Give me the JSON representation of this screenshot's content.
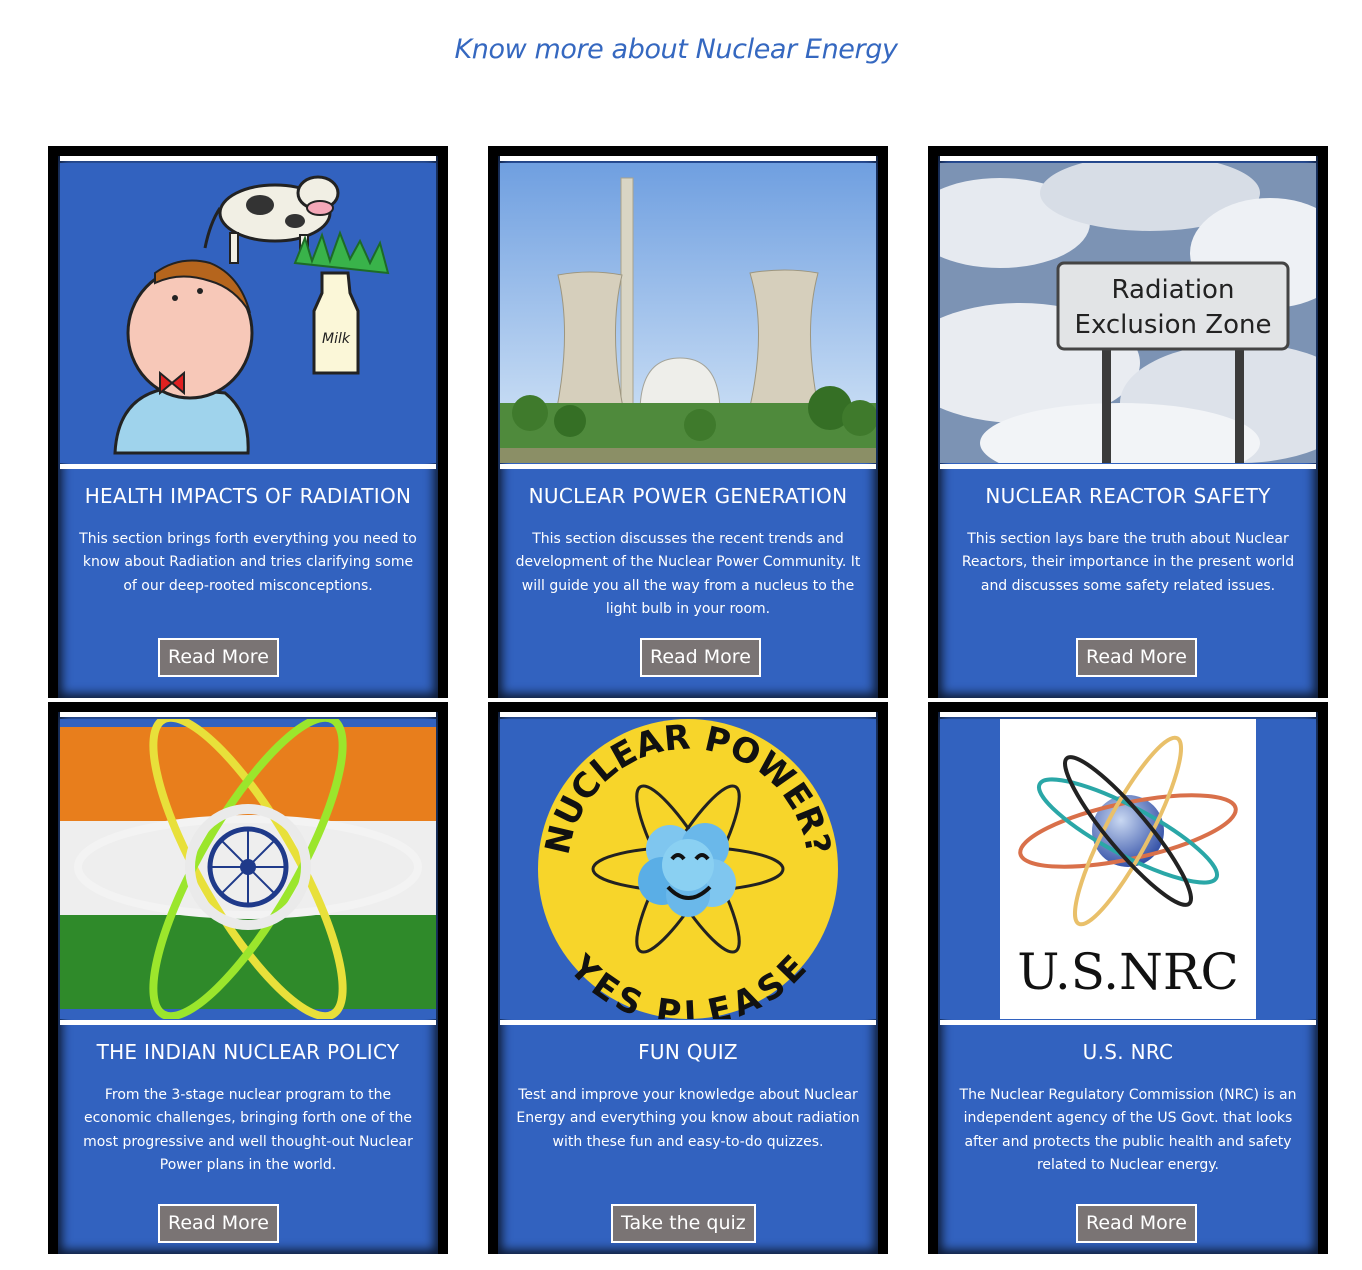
{
  "page": {
    "heading": "Know more about Nuclear Energy"
  },
  "cards": [
    {
      "title": "HEALTH IMPACTS OF RADIATION",
      "description": "This section brings forth everything you need to know about Radiation and tries clarifying some of our deep-rooted misconceptions.",
      "button": "Read More",
      "image": "cartoon-boy-cow-milk",
      "image_text": "Milk"
    },
    {
      "title": "NUCLEAR POWER GENERATION",
      "description": "This section discusses the recent trends and development of the Nuclear Power Community. It will guide you all the way from a nucleus to the light bulb in your room.",
      "button": "Read More",
      "image": "nuclear-power-plant-cooling-towers"
    },
    {
      "title": "NUCLEAR REACTOR SAFETY",
      "description": "This section lays bare the truth about Nuclear Reactors, their importance in the present world and discusses some safety related issues.",
      "button": "Read More",
      "image": "radiation-exclusion-zone-sign",
      "image_text": [
        "Radiation",
        "Exclusion Zone"
      ]
    },
    {
      "title": "THE INDIAN NUCLEAR POLICY",
      "description": "From the 3-stage nuclear program to the economic challenges, bringing forth one of the most progressive and well thought-out Nuclear Power plans in the world.",
      "button": "Read More",
      "image": "indian-flag-atom"
    },
    {
      "title": "FUN QUIZ",
      "description": "Test and improve your knowledge about Nuclear Energy and everything you know about radiation with these fun and easy-to-do quizzes.",
      "button": "Take the quiz",
      "image": "nuclear-power-yes-please-badge",
      "image_text": [
        "NUCLEAR POWER?",
        "YES PLEASE"
      ]
    },
    {
      "title": "U.S. NRC",
      "description": "The Nuclear Regulatory Commission (NRC) is an independent agency of the US Govt. that looks after and protects the public health and safety related to Nuclear energy.",
      "button": "Read More",
      "image": "us-nrc-logo",
      "image_text": "U.S.NRC"
    }
  ],
  "colors": {
    "heading": "#3568c0",
    "card_bg": "#3262bf",
    "card_border": "#000000",
    "button_bg": "#7a7474",
    "text": "#ffffff"
  }
}
